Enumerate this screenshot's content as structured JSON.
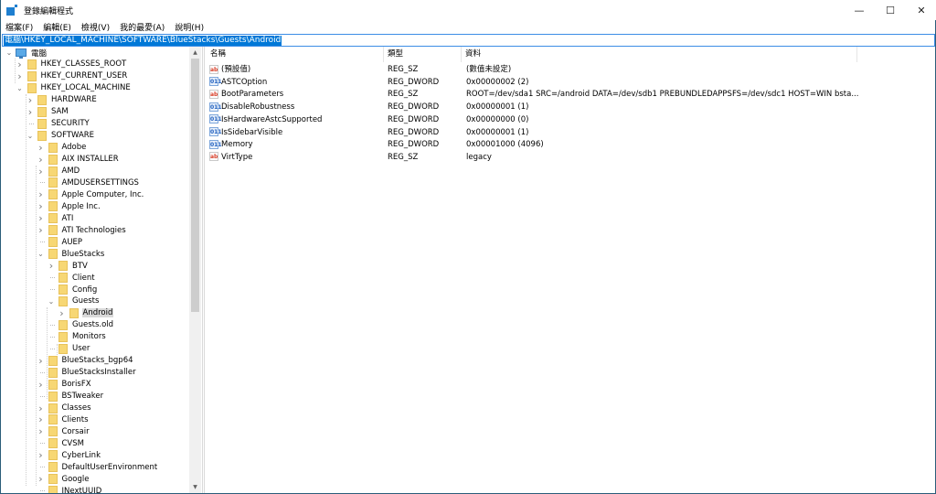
{
  "window": {
    "title": "登錄編輯程式",
    "controls": {
      "minimize": "—",
      "maximize": "☐",
      "close": "✕"
    }
  },
  "menu": [
    "檔案(F)",
    "編輯(E)",
    "檢視(V)",
    "我的最愛(A)",
    "說明(H)"
  ],
  "address": "電腦\\HKEY_LOCAL_MACHINE\\SOFTWARE\\BlueStacks\\Guests\\Android",
  "tree": {
    "root": "電腦",
    "items": [
      {
        "label": "HKEY_CLASSES_ROOT",
        "level": 1,
        "expander": "collapsed"
      },
      {
        "label": "HKEY_CURRENT_USER",
        "level": 1,
        "expander": "collapsed"
      },
      {
        "label": "HKEY_LOCAL_MACHINE",
        "level": 1,
        "expander": "expanded"
      },
      {
        "label": "HARDWARE",
        "level": 2,
        "expander": "collapsed"
      },
      {
        "label": "SAM",
        "level": 2,
        "expander": "collapsed"
      },
      {
        "label": "SECURITY",
        "level": 2,
        "expander": "none"
      },
      {
        "label": "SOFTWARE",
        "level": 2,
        "expander": "expanded"
      },
      {
        "label": "Adobe",
        "level": 3,
        "expander": "collapsed"
      },
      {
        "label": "AIX INSTALLER",
        "level": 3,
        "expander": "collapsed"
      },
      {
        "label": "AMD",
        "level": 3,
        "expander": "collapsed"
      },
      {
        "label": "AMDUSERSETTINGS",
        "level": 3,
        "expander": "none"
      },
      {
        "label": "Apple Computer, Inc.",
        "level": 3,
        "expander": "collapsed"
      },
      {
        "label": "Apple Inc.",
        "level": 3,
        "expander": "collapsed"
      },
      {
        "label": "ATI",
        "level": 3,
        "expander": "collapsed"
      },
      {
        "label": "ATI Technologies",
        "level": 3,
        "expander": "collapsed"
      },
      {
        "label": "AUEP",
        "level": 3,
        "expander": "none"
      },
      {
        "label": "BlueStacks",
        "level": 3,
        "expander": "expanded"
      },
      {
        "label": "BTV",
        "level": 4,
        "expander": "collapsed"
      },
      {
        "label": "Client",
        "level": 4,
        "expander": "none"
      },
      {
        "label": "Config",
        "level": 4,
        "expander": "none"
      },
      {
        "label": "Guests",
        "level": 4,
        "expander": "expanded"
      },
      {
        "label": "Android",
        "level": 5,
        "expander": "collapsed",
        "selected": true
      },
      {
        "label": "Guests.old",
        "level": 4,
        "expander": "none"
      },
      {
        "label": "Monitors",
        "level": 4,
        "expander": "none"
      },
      {
        "label": "User",
        "level": 4,
        "expander": "none"
      },
      {
        "label": "BlueStacks_bgp64",
        "level": 3,
        "expander": "collapsed"
      },
      {
        "label": "BlueStacksInstaller",
        "level": 3,
        "expander": "none"
      },
      {
        "label": "BorisFX",
        "level": 3,
        "expander": "collapsed"
      },
      {
        "label": "BSTweaker",
        "level": 3,
        "expander": "none"
      },
      {
        "label": "Classes",
        "level": 3,
        "expander": "collapsed"
      },
      {
        "label": "Clients",
        "level": 3,
        "expander": "collapsed"
      },
      {
        "label": "Corsair",
        "level": 3,
        "expander": "collapsed"
      },
      {
        "label": "CVSM",
        "level": 3,
        "expander": "none"
      },
      {
        "label": "CyberLink",
        "level": 3,
        "expander": "collapsed"
      },
      {
        "label": "DefaultUserEnvironment",
        "level": 3,
        "expander": "none"
      },
      {
        "label": "Google",
        "level": 3,
        "expander": "collapsed"
      },
      {
        "label": "INextUUID",
        "level": 3,
        "expander": "none"
      }
    ],
    "scrollbar": {
      "position_fraction": 0.0,
      "visible_fraction": 0.6
    }
  },
  "values": {
    "columns": [
      "名稱",
      "類型",
      "資料"
    ],
    "rows": [
      {
        "icon": "string-value-icon",
        "name": "(預設值)",
        "type": "REG_SZ",
        "data": "(數值未設定)"
      },
      {
        "icon": "dword-value-icon",
        "name": "ASTCOption",
        "type": "REG_DWORD",
        "data": "0x00000002 (2)"
      },
      {
        "icon": "string-value-icon",
        "name": "BootParameters",
        "type": "REG_SZ",
        "data": "ROOT=/dev/sda1 SRC=/android DATA=/dev/sdb1 PREBUNDLEDAPPSFS=/dev/sdc1 HOST=WIN bsta..."
      },
      {
        "icon": "dword-value-icon",
        "name": "DisableRobustness",
        "type": "REG_DWORD",
        "data": "0x00000001 (1)"
      },
      {
        "icon": "dword-value-icon",
        "name": "IsHardwareAstcSupported",
        "type": "REG_DWORD",
        "data": "0x00000000 (0)"
      },
      {
        "icon": "dword-value-icon",
        "name": "IsSidebarVisible",
        "type": "REG_DWORD",
        "data": "0x00000001 (1)"
      },
      {
        "icon": "dword-value-icon",
        "name": "Memory",
        "type": "REG_DWORD",
        "data": "0x00001000 (4096)"
      },
      {
        "icon": "string-value-icon",
        "name": "VirtType",
        "type": "REG_SZ",
        "data": "legacy"
      }
    ]
  },
  "icons": {
    "string_glyph": "ab",
    "dword_glyph": "011",
    "chevron_right": "›",
    "chevron_down": "⌄",
    "scroll_up": "▲",
    "scroll_down": "▼"
  },
  "colors": {
    "selection": "#0078d7",
    "address_border": "#3c8de6",
    "folder": "#f7d774",
    "tree_selected": "#d9d9d9"
  }
}
